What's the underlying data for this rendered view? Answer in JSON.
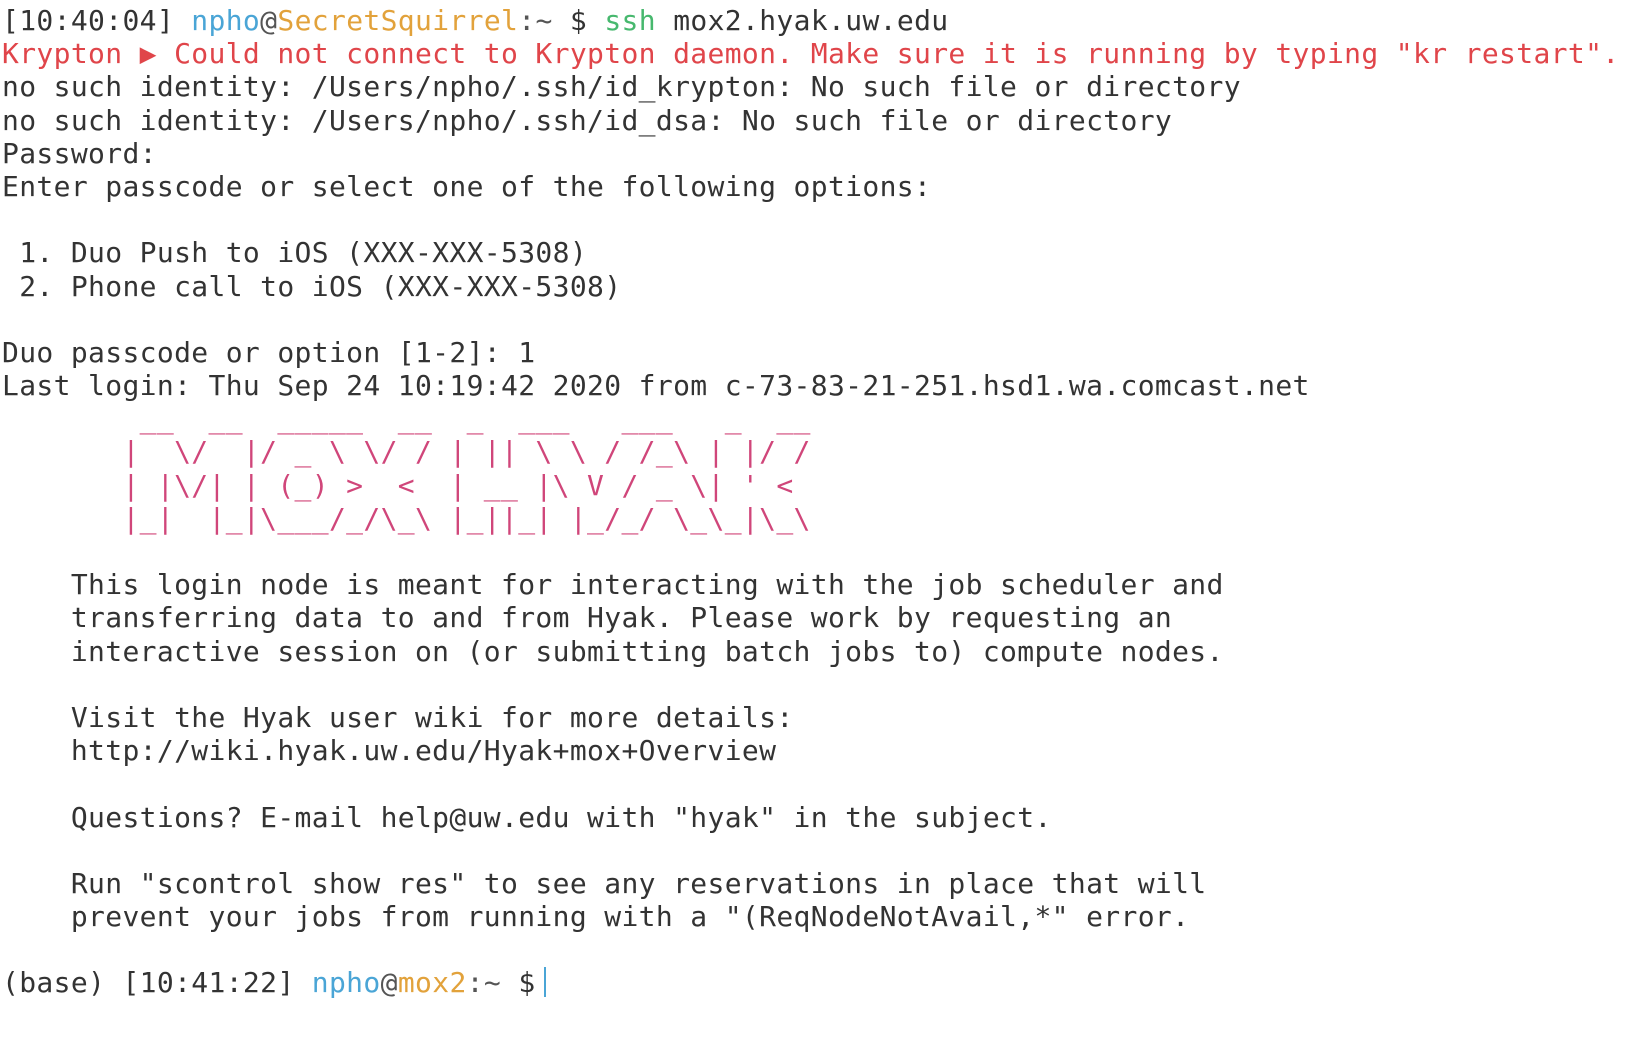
{
  "prompt1": {
    "time": "[10:40:04]",
    "user": "npho",
    "at": "@",
    "host": "SecretSquirrel",
    "path": ":~",
    "dollar": "$",
    "command": "ssh",
    "args": "mox2.hyak.uw.edu"
  },
  "output": {
    "krypton_error": "Krypton ▶ Could not connect to Krypton daemon. Make sure it is running by typing \"kr restart\".",
    "no_identity_1": "no such identity: /Users/npho/.ssh/id_krypton: No such file or directory",
    "no_identity_2": "no such identity: /Users/npho/.ssh/id_dsa: No such file or directory",
    "password": "Password:",
    "passcode_prompt": "Enter passcode or select one of the following options:",
    "option_1": " 1. Duo Push to iOS (XXX-XXX-5308)",
    "option_2": " 2. Phone call to iOS (XXX-XXX-5308)",
    "duo_choice": "Duo passcode or option [1-2]: 1",
    "last_login": "Last login: Thu Sep 24 10:19:42 2020 from c-73-83-21-251.hsd1.wa.comcast.net"
  },
  "banner": {
    "ascii_line_1": "        __  __  _____  __  _  ___   ___   _  __",
    "ascii_line_2": "       |  \\/  |/ _ \\ \\/ / | || \\ \\ / /_\\ | |/ /",
    "ascii_line_3": "       | |\\/| | (_) >  <  | __ |\\ V / _ \\| ' <",
    "ascii_line_4": "       |_|  |_|\\___/_/\\_\\ |_||_| |_/_/ \\_\\_|\\_\\",
    "motd_1": "    This login node is meant for interacting with the job scheduler and",
    "motd_2": "    transferring data to and from Hyak. Please work by requesting an",
    "motd_3": "    interactive session on (or submitting batch jobs to) compute nodes.",
    "motd_4": "    Visit the Hyak user wiki for more details:",
    "motd_5": "    http://wiki.hyak.uw.edu/Hyak+mox+Overview",
    "motd_6": "    Questions? E-mail help@uw.edu with \"hyak\" in the subject.",
    "motd_7": "    Run \"scontrol show res\" to see any reservations in place that will",
    "motd_8": "    prevent your jobs from running with a \"(ReqNodeNotAvail,*\" error."
  },
  "prompt2": {
    "env": "(base)",
    "time": "[10:41:22]",
    "user": "npho",
    "at": "@",
    "host": "mox2",
    "path": ":~",
    "dollar": "$"
  },
  "colors": {
    "user": "#4aa5d6",
    "host": "#e2a23b",
    "command": "#47b86e",
    "error": "#e0454a",
    "banner": "#d0467a",
    "text": "#333333"
  }
}
